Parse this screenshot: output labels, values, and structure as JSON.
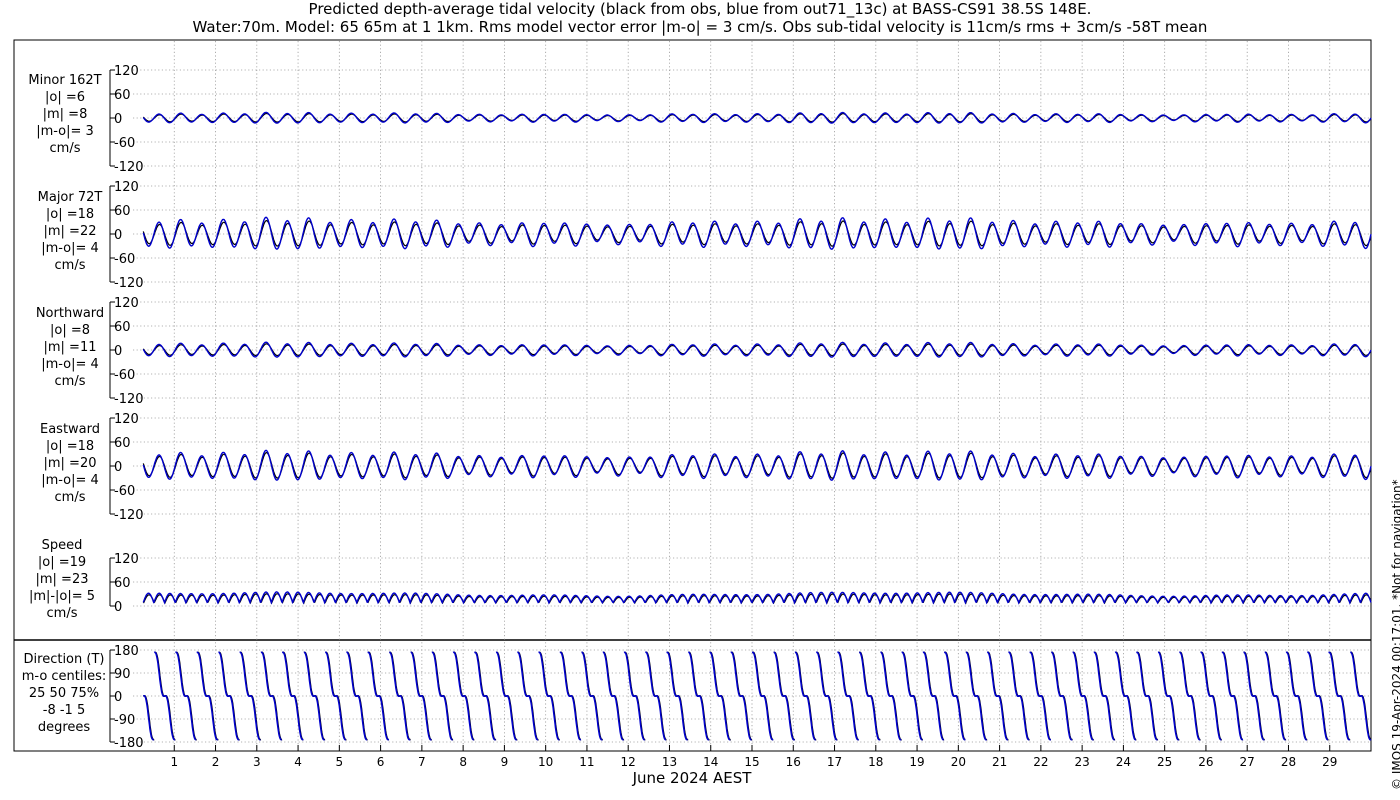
{
  "titles": {
    "line1": "Predicted depth-average tidal velocity (black from obs, blue from out71_13c) at BASS-CS91 38.5S 148E.",
    "line2": "Water:70m. Model: 65 65m at 1 1km. Rms model vector error |m-o| = 3 cm/s. Obs sub-tidal velocity is 11cm/s rms + 3cm/s -58T mean"
  },
  "copyright": "© IMOS 19-Apr-2024 00:17:01. *Not for navigation*",
  "colors": {
    "obs": "#000000",
    "model": "#0000cc",
    "grid": "#9a9a9a",
    "frame": "#000000"
  },
  "chart_data": {
    "type": "line",
    "xlabel": "June 2024 AEST",
    "x_ticks": [
      "1",
      "2",
      "3",
      "4",
      "5",
      "6",
      "7",
      "8",
      "9",
      "10",
      "11",
      "12",
      "13",
      "14",
      "15",
      "16",
      "17",
      "18",
      "19",
      "20",
      "21",
      "22",
      "23",
      "24",
      "25",
      "26",
      "27",
      "28",
      "29"
    ],
    "xlim_days": [
      0,
      30
    ],
    "grid": true,
    "series_styles": [
      {
        "name": "obs",
        "color": "#000000"
      },
      {
        "name": "model",
        "color": "#0000cc"
      }
    ],
    "panels": [
      {
        "id": "minor",
        "label_lines": [
          "Minor 162T",
          "|o| =6",
          "|m| =8",
          "|m-o|= 3",
          "cm/s"
        ],
        "ylim": [
          -120,
          120
        ],
        "yticks": [
          "120",
          "60",
          "0",
          "-60",
          "-120"
        ],
        "yvals": [
          120,
          60,
          0,
          -60,
          -120
        ],
        "kind": "component",
        "obs_amp": 8,
        "model_amp": 10,
        "mean": 0
      },
      {
        "id": "major",
        "label_lines": [
          "Major 72T",
          "|o| =18",
          "|m| =22",
          "|m-o|= 4",
          "cm/s"
        ],
        "ylim": [
          -120,
          120
        ],
        "yticks": [
          "120",
          "60",
          "0",
          "-60",
          "-120"
        ],
        "yvals": [
          120,
          60,
          0,
          -60,
          -120
        ],
        "kind": "component",
        "obs_amp": 24,
        "model_amp": 30,
        "mean": 0
      },
      {
        "id": "north",
        "label_lines": [
          "Northward",
          "|o| =8",
          "|m| =11",
          "|m-o|= 4",
          "cm/s"
        ],
        "ylim": [
          -120,
          120
        ],
        "yticks": [
          "120",
          "60",
          "0",
          "-60",
          "-120"
        ],
        "yvals": [
          120,
          60,
          0,
          -60,
          -120
        ],
        "kind": "component",
        "obs_amp": 11,
        "model_amp": 14,
        "mean": 0
      },
      {
        "id": "east",
        "label_lines": [
          "Eastward",
          "|o| =18",
          "|m| =20",
          "|m-o|= 4",
          "cm/s"
        ],
        "ylim": [
          -120,
          120
        ],
        "yticks": [
          "120",
          "60",
          "0",
          "-60",
          "-120"
        ],
        "yvals": [
          120,
          60,
          0,
          -60,
          -120
        ],
        "kind": "component",
        "obs_amp": 24,
        "model_amp": 28,
        "mean": 0
      },
      {
        "id": "speed",
        "label_lines": [
          "Speed",
          "|o| =19",
          "|m| =23",
          "|m|-|o|= 5",
          "cm/s"
        ],
        "ylim": [
          0,
          120
        ],
        "yticks": [
          "120",
          "60",
          "0"
        ],
        "yvals": [
          120,
          60,
          0
        ],
        "kind": "speed",
        "obs_amp": 20,
        "model_amp": 24,
        "mean": 0
      },
      {
        "id": "direction",
        "label_lines": [
          "Direction (T)",
          "m-o centiles:",
          "25  50  75%",
          "-8 -1  5",
          "degrees"
        ],
        "ylim": [
          -180,
          180
        ],
        "yticks": [
          "180",
          "90",
          "0",
          "-90",
          "-180"
        ],
        "yvals": [
          180,
          90,
          0,
          -90,
          -180
        ],
        "kind": "direction"
      }
    ]
  }
}
